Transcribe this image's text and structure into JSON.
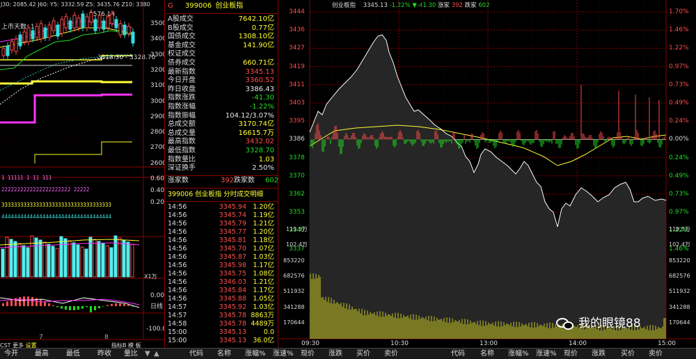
{
  "left_panel": {
    "header": "J30: 2085.42 J60: Y5: 3332.59 Z5: 3435.76 Z10: 3380",
    "sub_label": "上市天数: 1",
    "price_high_marker": "3576.13",
    "price_low_marker": "3318.50 - 3328.70",
    "price_axis": [
      "3500",
      "3400",
      "3300",
      "3200",
      "3100",
      "3000",
      "2900",
      "2800",
      "2700",
      "2600"
    ],
    "indicator_axis": [
      "0.60",
      "0.40",
      "0.20",
      "日线"
    ],
    "volume_axis_label": "X1万",
    "macd_axis": [
      "0.00",
      "-100.0"
    ],
    "month_labels": [
      "7",
      "8"
    ],
    "tabs_small": [
      "CST",
      "更多",
      "设置"
    ],
    "tabs_small2": [
      "指标B",
      "模",
      "板"
    ],
    "buttons": [
      "今开",
      "最高",
      "最低",
      "昨收",
      "量比"
    ]
  },
  "mid_panel": {
    "code_prefix": "G",
    "code": "399006",
    "name": "创业板指",
    "stats": [
      {
        "k": "A股成交",
        "v": "7642.10亿",
        "c": "yellow"
      },
      {
        "k": "B股成交",
        "v": "0.77亿",
        "c": "yellow"
      },
      {
        "k": "国债成交",
        "v": "1308.10亿",
        "c": "yellow"
      },
      {
        "k": "基金成交",
        "v": "141.90亿",
        "c": "yellow"
      },
      {
        "k": "权证成交",
        "v": "",
        "c": "yellow"
      },
      {
        "k": "债券成交",
        "v": "660.71亿",
        "c": "yellow"
      },
      {
        "k": "最新指数",
        "v": "3345.13",
        "c": "red"
      },
      {
        "k": "今日开盘",
        "v": "3360.52",
        "c": "red"
      },
      {
        "k": "昨日收盘",
        "v": "3386.43",
        "c": "white"
      },
      {
        "k": "指数涨跌",
        "v": "-41.30",
        "c": "green"
      },
      {
        "k": "指数涨幅",
        "v": "-1.22%",
        "c": "green"
      },
      {
        "k": "指数振幅",
        "v": "104.12/3.07%",
        "c": "white"
      },
      {
        "k": "总成交额",
        "v": "3170.74亿",
        "c": "yellow"
      },
      {
        "k": "总成交量",
        "v": "16615.7万",
        "c": "yellow"
      },
      {
        "k": "最高指数",
        "v": "3432.02",
        "c": "red"
      },
      {
        "k": "最低指数",
        "v": "3328.70",
        "c": "green"
      },
      {
        "k": "指数量比",
        "v": "1.03",
        "c": "yellow"
      },
      {
        "k": "深证换手",
        "v": "2.50%",
        "c": "white"
      }
    ],
    "up_label": "涨家数",
    "up_count": "392",
    "down_label": "跌家数",
    "down_count": "602",
    "detail_title": "399006 创业板指 分时成交明细",
    "ticks": [
      {
        "t": "14:56",
        "p": "3345.94",
        "v": "1.20亿"
      },
      {
        "t": "14:56",
        "p": "3345.74",
        "v": "1.19亿"
      },
      {
        "t": "14:56",
        "p": "3345.79",
        "v": "1.21亿"
      },
      {
        "t": "14:56",
        "p": "3345.77",
        "v": "1.20亿"
      },
      {
        "t": "14:56",
        "p": "3345.81",
        "v": "1.18亿"
      },
      {
        "t": "14:56",
        "p": "3345.70",
        "v": "1.07亿"
      },
      {
        "t": "14:56",
        "p": "3345.87",
        "v": "1.03亿"
      },
      {
        "t": "14:56",
        "p": "3345.98",
        "v": "1.17亿"
      },
      {
        "t": "14:56",
        "p": "3345.75",
        "v": "1.08亿"
      },
      {
        "t": "14:56",
        "p": "3346.03",
        "v": "1.21亿"
      },
      {
        "t": "14:56",
        "p": "3345.84",
        "v": "1.17亿"
      },
      {
        "t": "14:56",
        "p": "3345.88",
        "v": "1.05亿"
      },
      {
        "t": "14:57",
        "p": "3345.92",
        "v": "1.03亿"
      },
      {
        "t": "14:57",
        "p": "3345.78",
        "v": "8863万"
      },
      {
        "t": "14:58",
        "p": "3345.78",
        "v": "4489万"
      },
      {
        "t": "15:00",
        "p": "3345.13",
        "v": "0.0"
      },
      {
        "t": "15:00",
        "p": "3345.13",
        "v": "36.0亿"
      }
    ]
  },
  "right_panel": {
    "title": "创业板指",
    "price": "3345.13",
    "change": "-1.22%",
    "delta": "▼-41.30",
    "up_label": "涨家",
    "up": "392",
    "down_label": "跌家",
    "down": "602",
    "left_axis": [
      "3444",
      "3436",
      "3427",
      "3419",
      "3411",
      "3403",
      "3395",
      "3386",
      "3378",
      "3370",
      "3362",
      "3353",
      "3345",
      "3337"
    ],
    "right_axis": [
      "1.70%",
      "1.46%",
      "1.22%",
      "0.97%",
      "0.73%",
      "0.49%",
      "0.24%",
      "0.00%",
      "0.24%",
      "0.49%",
      "0.73%",
      "0.97%",
      "1.22%",
      "1.46%"
    ],
    "vol_axis": [
      "119.5万",
      "102.4万",
      "853220",
      "682576",
      "511932",
      "341288",
      "170644"
    ],
    "time_labels": [
      "09:30",
      "10:30",
      "13:00",
      "14:00",
      "15:00"
    ],
    "watermark": "我的眼镜88"
  },
  "bottom_bar": {
    "left_tabs": [
      "今开",
      "最高",
      "最低",
      "昨收",
      "量比"
    ],
    "arrows": [
      "▼",
      "▲"
    ],
    "cols": [
      "代码",
      "名称",
      "涨幅%",
      "涨速%",
      "现价",
      "涨跌",
      "买价",
      "卖价",
      "代码",
      "名称",
      "涨幅%",
      "涨速%",
      "现价",
      "涨跌",
      "买价",
      "卖价"
    ]
  },
  "colors": {
    "up": "#ff4d4d",
    "down": "#22dd22",
    "grid": "#8b0000",
    "line_main": "#ffffff",
    "line_avg": "#ffff33"
  }
}
